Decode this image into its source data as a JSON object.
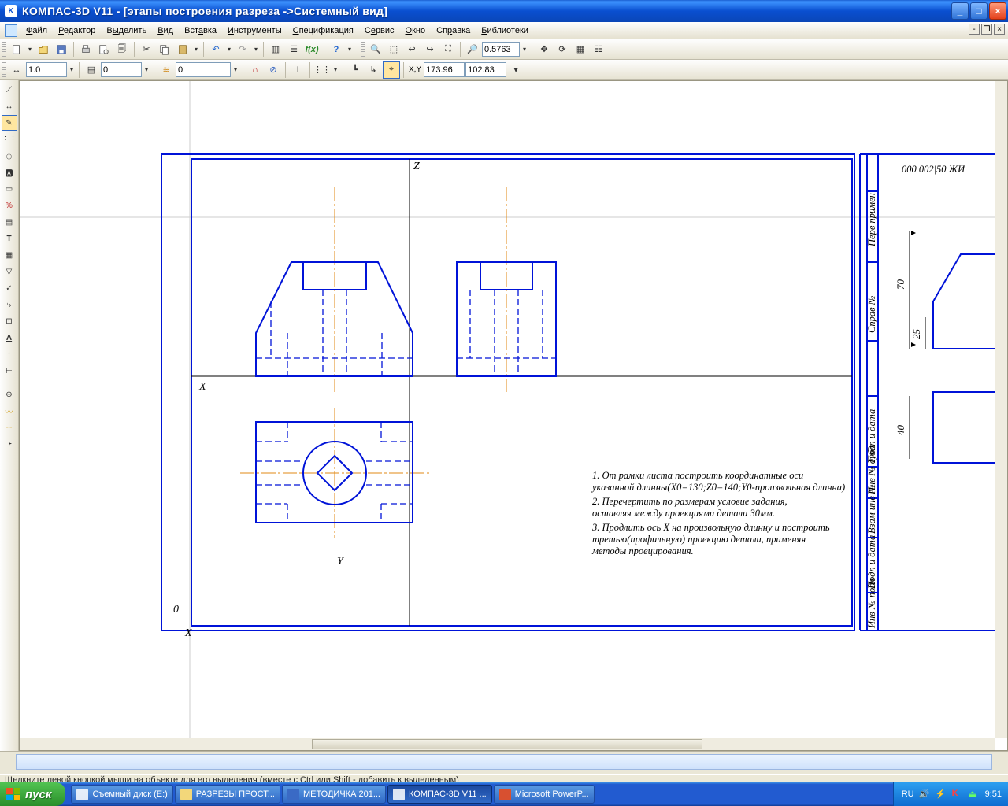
{
  "title": {
    "app": "КОМПАС-3D V11",
    "doc": " - [этапы построения разреза ->Системный вид]"
  },
  "menu": {
    "file": "Файл",
    "edit": "Редактор",
    "select": "Выделить",
    "view": "Вид",
    "insert": "Вставка",
    "tools": "Инструменты",
    "spec": "Спецификация",
    "service": "Сервис",
    "window": "Окно",
    "help": "Справка",
    "libs": "Библиотеки"
  },
  "toolbar2": {
    "zoom": "0.5763"
  },
  "toolbar3": {
    "step": "1.0",
    "style": "0",
    "layer": "0",
    "x": "173.96",
    "y": "102.83",
    "xy_prefix": "X,Y"
  },
  "drawing": {
    "axes": {
      "x": "X",
      "y": "Y",
      "z": "Z",
      "origin": "0"
    },
    "notes": {
      "l1": "1. От рамки листа построить координатные оси",
      "l2": "указанной длинны(X0=130;Z0=140;Y0-произвольная длинна)",
      "l3": "2. Перечертить по размерам условие задания,",
      "l4": "оставляя между проекциями детали 30мм.",
      "l5": "3. Продлить ось X на произвольную длинну и построить",
      "l6": "третью(профильную) проекцию детали, применяя",
      "l7": "методы проецирования."
    },
    "dims": {
      "d1": "70",
      "d2": "25",
      "d3": "40"
    },
    "title_block": {
      "code": "000 002|50 ЖИ",
      "c1": "Перв примен",
      "c2": "Справ №",
      "c3": "Подп и дата",
      "c4": "Инв № дубл",
      "c5": "Взам инв №",
      "c6": "Подп и дата",
      "c7": "Инв № подл"
    }
  },
  "statusbar": {
    "hint": "Щелкните левой кнопкой мыши на объекте для его выделения (вместе с Ctrl или Shift - добавить к выделенным)"
  },
  "taskbar": {
    "start": "пуск",
    "t1": "Съемный диск (E:)",
    "t2": "РАЗРЕЗЫ ПРОСТ...",
    "t3": "МЕТОДИЧКА 201...",
    "t4": "КОМПАС-3D V11 ...",
    "t5": "Microsoft PowerP...",
    "lang": "RU",
    "clock": "9:51"
  }
}
